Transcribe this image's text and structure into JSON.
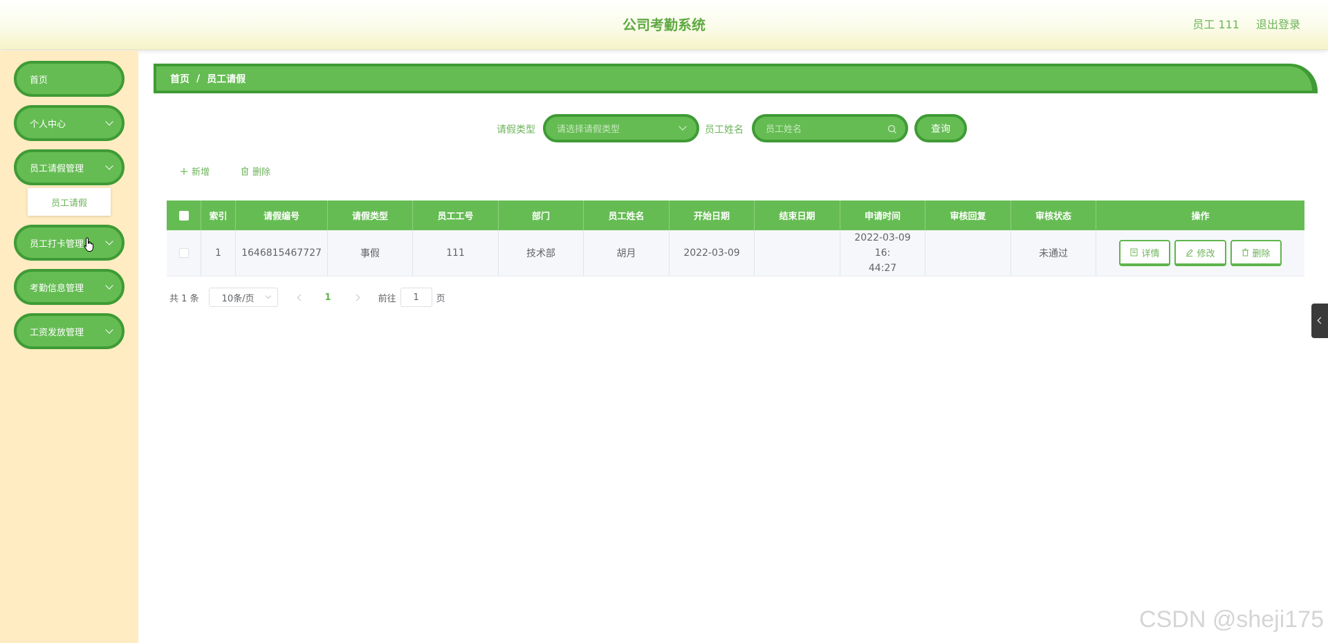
{
  "header": {
    "title": "公司考勤系统",
    "user_label": "员工 111",
    "logout_label": "退出登录"
  },
  "sidebar": {
    "items": [
      {
        "label": "首页"
      },
      {
        "label": "个人中心"
      },
      {
        "label": "员工请假管理"
      },
      {
        "label": "员工打卡管理"
      },
      {
        "label": "考勤信息管理"
      },
      {
        "label": "工资发放管理"
      }
    ],
    "submenu": {
      "label": "员工请假"
    }
  },
  "breadcrumb": {
    "home": "首页",
    "sep": "/",
    "current": "员工请假"
  },
  "search": {
    "leave_type_label": "请假类型",
    "leave_type_placeholder": "请选择请假类型",
    "name_label": "员工姓名",
    "name_placeholder": "员工姓名",
    "query_label": "查询"
  },
  "actions": {
    "add_label": "新增",
    "delete_label": "删除"
  },
  "table": {
    "columns": [
      "索引",
      "请假编号",
      "请假类型",
      "员工工号",
      "部门",
      "员工姓名",
      "开始日期",
      "结束日期",
      "申请时间",
      "审核回复",
      "审核状态",
      "操作"
    ],
    "rows": [
      {
        "index": "1",
        "leave_no": "1646815467727",
        "leave_type": "事假",
        "emp_no": "111",
        "dept": "技术部",
        "emp_name": "胡月",
        "start_date": "2022-03-09",
        "end_date": "",
        "apply_time_line1": "2022-03-09 16:",
        "apply_time_line2": "44:27",
        "reply": "",
        "status": "未通过",
        "ops": {
          "detail": "详情",
          "edit": "修改",
          "delete": "删除"
        }
      }
    ]
  },
  "pagination": {
    "total": "共 1 条",
    "page_size": "10条/页",
    "current_page": "1",
    "goto_prefix": "前往",
    "goto_value": "1",
    "goto_suffix": "页"
  },
  "watermark": "CSDN @sheji175",
  "colors": {
    "primary": "#65bc53",
    "primary_border": "#3f9b35",
    "text_green": "#6db35a",
    "sidebar_bg": "#ffecc2"
  }
}
